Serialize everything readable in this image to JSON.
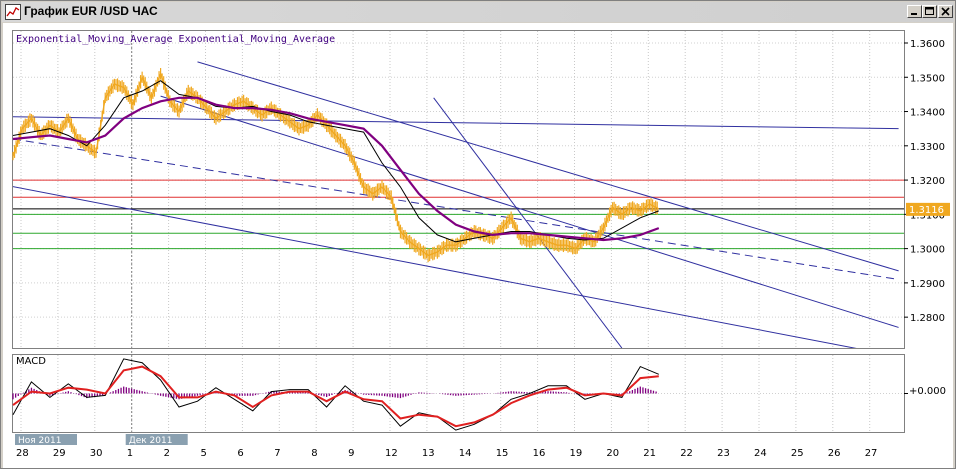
{
  "window": {
    "title": "График EUR /USD  ЧАС",
    "icons": {
      "app": "chart-icon",
      "minimize": "minimize-icon",
      "maximize": "maximize-icon",
      "close": "close-icon"
    }
  },
  "chart_data": [
    {
      "type": "line",
      "panel": "price",
      "indicator_label": "Exponential_Moving_Average Exponential_Moving_Average",
      "current_price_label": "1.3116",
      "ylim": [
        1.271,
        1.3635
      ],
      "y_ticks": [
        "1.3600",
        "1.3500",
        "1.3400",
        "1.3300",
        "1.3200",
        "1.3100",
        "1.3000",
        "1.2900",
        "1.2800"
      ],
      "x_day_ticks": [
        "28",
        "29",
        "30",
        "1",
        "2",
        "5",
        "6",
        "7",
        "8",
        "9",
        "12",
        "13",
        "14",
        "15",
        "16",
        "19",
        "20",
        "21",
        "22",
        "23",
        "24",
        "25",
        "26",
        "27"
      ],
      "month_labels": [
        {
          "label": "Ноя 2011",
          "at_tick": 0
        },
        {
          "label": "Дек 2011",
          "at_tick": 3
        }
      ],
      "grid": true,
      "horizontal_levels": [
        {
          "value": 1.32,
          "color": "#e03030"
        },
        {
          "value": 1.315,
          "color": "#e03030"
        },
        {
          "value": 1.3116,
          "color": "#000000"
        },
        {
          "value": 1.31,
          "color": "#2ea82e"
        },
        {
          "value": 1.3045,
          "color": "#2ea82e"
        },
        {
          "value": 1.3,
          "color": "#2ea82e"
        }
      ],
      "price_series": {
        "color": "#f0a820",
        "x": [
          0,
          0.25,
          0.5,
          0.75,
          1,
          1.25,
          1.5,
          1.75,
          2,
          2.25,
          2.5,
          2.75,
          3,
          3.25,
          3.5,
          3.75,
          4,
          4.25,
          4.5,
          4.75,
          5,
          5.25,
          5.5,
          5.75,
          6,
          6.25,
          6.5,
          6.75,
          7,
          7.25,
          7.5,
          7.75,
          8,
          8.25,
          8.5,
          8.75,
          9,
          9.25,
          9.5,
          9.75,
          10,
          10.25,
          10.5,
          10.75,
          11,
          11.25,
          11.5,
          11.75,
          12,
          12.25,
          12.5,
          12.75,
          13,
          13.25,
          13.5,
          13.75,
          14,
          14.25,
          14.5,
          14.75,
          15,
          15.25,
          15.5,
          15.75,
          16,
          16.25,
          16.5,
          16.75,
          17,
          17.25,
          17.5
        ],
        "values": [
          1.327,
          1.335,
          1.338,
          1.333,
          1.336,
          1.334,
          1.338,
          1.332,
          1.33,
          1.328,
          1.344,
          1.348,
          1.347,
          1.342,
          1.35,
          1.344,
          1.351,
          1.343,
          1.34,
          1.346,
          1.344,
          1.341,
          1.338,
          1.34,
          1.342,
          1.343,
          1.341,
          1.339,
          1.341,
          1.339,
          1.337,
          1.335,
          1.336,
          1.339,
          1.336,
          1.333,
          1.33,
          1.325,
          1.318,
          1.316,
          1.318,
          1.315,
          1.305,
          1.302,
          1.3,
          1.298,
          1.299,
          1.301,
          1.301,
          1.303,
          1.305,
          1.304,
          1.303,
          1.306,
          1.309,
          1.303,
          1.302,
          1.303,
          1.302,
          1.301,
          1.301,
          1.3,
          1.303,
          1.302,
          1.306,
          1.312,
          1.31,
          1.312,
          1.311,
          1.313,
          1.3116
        ]
      },
      "ema_slow": {
        "color": "#800080",
        "x": [
          0,
          0.5,
          1,
          1.5,
          2,
          2.5,
          3,
          3.5,
          4,
          4.5,
          5,
          5.5,
          6,
          6.5,
          7,
          7.5,
          8,
          8.5,
          9,
          9.5,
          10,
          10.5,
          11,
          11.5,
          12,
          12.5,
          13,
          13.5,
          14,
          14.5,
          15,
          15.5,
          16,
          16.5,
          17,
          17.5
        ],
        "values": [
          1.332,
          1.3325,
          1.333,
          1.332,
          1.331,
          1.333,
          1.338,
          1.341,
          1.343,
          1.344,
          1.344,
          1.342,
          1.341,
          1.341,
          1.3405,
          1.3395,
          1.338,
          1.337,
          1.336,
          1.335,
          1.33,
          1.323,
          1.316,
          1.311,
          1.307,
          1.305,
          1.304,
          1.3045,
          1.3045,
          1.304,
          1.3035,
          1.303,
          1.3025,
          1.303,
          1.304,
          1.306
        ]
      },
      "ema_fast": {
        "color": "#000000",
        "x": [
          0,
          0.5,
          1,
          1.5,
          2,
          2.5,
          3,
          3.5,
          4,
          4.5,
          5,
          5.5,
          6,
          6.5,
          7,
          7.5,
          8,
          8.5,
          9,
          9.5,
          10,
          10.5,
          11,
          11.5,
          12,
          12.5,
          13,
          13.5,
          14,
          14.5,
          15,
          15.5,
          16,
          16.5,
          17,
          17.5
        ],
        "values": [
          1.333,
          1.334,
          1.335,
          1.333,
          1.33,
          1.336,
          1.344,
          1.346,
          1.349,
          1.345,
          1.344,
          1.3415,
          1.341,
          1.3415,
          1.34,
          1.339,
          1.337,
          1.336,
          1.335,
          1.334,
          1.325,
          1.318,
          1.309,
          1.304,
          1.302,
          1.303,
          1.304,
          1.305,
          1.305,
          1.304,
          1.303,
          1.3025,
          1.303,
          1.306,
          1.309,
          1.311
        ]
      },
      "trend_lines": [
        {
          "color": "#3030a0",
          "dash": false,
          "x": [
            5,
            24
          ],
          "values": [
            1.3545,
            1.2935
          ]
        },
        {
          "color": "#3030a0",
          "dash": false,
          "x": [
            4,
            24
          ],
          "values": [
            1.3445,
            1.277
          ]
        },
        {
          "color": "#3030a0",
          "dash": true,
          "x": [
            0,
            24
          ],
          "values": [
            1.332,
            1.291
          ]
        },
        {
          "color": "#3030a0",
          "dash": false,
          "x": [
            -0.2,
            24
          ],
          "values": [
            1.3385,
            1.335
          ]
        },
        {
          "color": "#3030a0",
          "dash": false,
          "x": [
            -0.2,
            24
          ],
          "values": [
            1.3185,
            1.2685
          ]
        },
        {
          "color": "#3030a0",
          "dash": false,
          "x": [
            11.4,
            16.5
          ],
          "values": [
            1.344,
            1.271
          ]
        }
      ]
    },
    {
      "type": "line",
      "panel": "macd",
      "title": "MACD",
      "zero_label": "+0.000",
      "ylim": [
        -1,
        1
      ],
      "macd_line": {
        "color": "#000000",
        "x": [
          0,
          0.5,
          1,
          1.5,
          2,
          2.5,
          3,
          3.5,
          4,
          4.5,
          5,
          5.5,
          6,
          6.5,
          7,
          7.5,
          8,
          8.5,
          9,
          9.5,
          10,
          10.5,
          11,
          11.5,
          12,
          12.5,
          13,
          13.5,
          14,
          14.5,
          15,
          15.5,
          16,
          16.5,
          17,
          17.5
        ],
        "values": [
          -0.55,
          0.3,
          -0.1,
          0.25,
          -0.1,
          -0.05,
          0.9,
          0.8,
          0.35,
          -0.35,
          -0.2,
          0.15,
          -0.15,
          -0.45,
          0.05,
          0.1,
          0.1,
          -0.35,
          0.2,
          -0.2,
          -0.3,
          -0.85,
          -0.5,
          -0.6,
          -0.95,
          -0.8,
          -0.55,
          -0.15,
          0.0,
          0.2,
          0.2,
          -0.15,
          0.0,
          -0.1,
          0.7,
          0.5
        ]
      },
      "signal_line": {
        "color": "#e02020",
        "x": [
          0,
          0.5,
          1,
          1.5,
          2,
          2.5,
          3,
          3.5,
          4,
          4.5,
          5,
          5.5,
          6,
          6.5,
          7,
          7.5,
          8,
          8.5,
          9,
          9.5,
          10,
          10.5,
          11,
          11.5,
          12,
          12.5,
          13,
          13.5,
          14,
          14.5,
          15,
          15.5,
          16,
          16.5,
          17,
          17.5
        ],
        "values": [
          -0.3,
          0.05,
          0.0,
          0.15,
          0.1,
          0.0,
          0.6,
          0.7,
          0.45,
          -0.1,
          -0.1,
          0.05,
          -0.05,
          -0.35,
          -0.05,
          0.05,
          0.05,
          -0.2,
          0.05,
          -0.15,
          -0.2,
          -0.65,
          -0.55,
          -0.6,
          -0.85,
          -0.75,
          -0.55,
          -0.25,
          -0.05,
          0.1,
          0.15,
          -0.05,
          0.0,
          -0.05,
          0.4,
          0.45
        ]
      },
      "histogram_color": "#800080"
    }
  ]
}
